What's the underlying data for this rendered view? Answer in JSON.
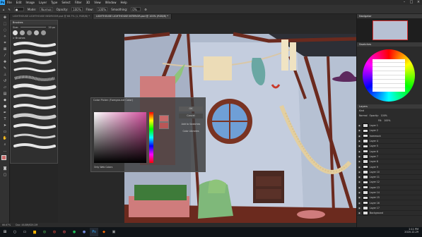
{
  "menubar": {
    "logo": "Ps",
    "items": [
      "File",
      "Edit",
      "Image",
      "Layer",
      "Type",
      "Select",
      "Filter",
      "3D",
      "View",
      "Window",
      "Help"
    ]
  },
  "options": {
    "mode_label": "Mode:",
    "mode_value": "Normal",
    "opacity_label": "Opacity:",
    "opacity_value": "100%",
    "flow_label": "Flow:",
    "flow_value": "100%",
    "smoothing_label": "Smoothing:",
    "smoothing_value": "0%"
  },
  "tabs": [
    {
      "label": "LIGHTHOUSE LIGHTHOUSE BEDROOM.psd @ 66.7% (1, RGB/8) *",
      "active": false
    },
    {
      "label": "LIGHTHOUSE LIGHTHOUSE INTERIOR.psd @ 100% (RGB/8) *",
      "active": true
    }
  ],
  "brush_panel": {
    "title": "Brushes",
    "size_label": "Size:",
    "size_value": "20 px",
    "group": "> Brushes"
  },
  "color_picker": {
    "title": "Color Picker (Foreground Color)",
    "ok": "OK",
    "cancel": "Cancel",
    "add_swatch": "Add to Swatches",
    "libraries": "Color Libraries",
    "only_web": "Only Web Colors"
  },
  "right_dock": {
    "navigator_title": "Navigator",
    "swatches_title": "Swatches",
    "layers_title": "Layers",
    "kind_label": "Kind",
    "blend_mode": "Normal",
    "opacity_label": "Opacity:",
    "opacity_value": "100%",
    "fill_label": "Fill:",
    "fill_value": "100%",
    "layers": [
      "Layer 1",
      "Layer 2",
      "hammock",
      "Layer 4",
      "Layer 5",
      "Layer 6",
      "Layer 7",
      "Layer 8",
      "Layer 9",
      "Layer 10",
      "Layer 11",
      "Layer 12",
      "Layer 13",
      "Layer 14",
      "Layer 15",
      "Layer 16",
      "Layer 17",
      "Background"
    ]
  },
  "status": {
    "zoom": "66.67%",
    "doc": "Doc: 46.8M/629.2M"
  },
  "taskbar": {
    "time": "2:11 PM",
    "date": "2020-12-29"
  },
  "colors": {
    "app_bg": "#262626",
    "wall": "#b9c4d8",
    "beam": "#6b2a1e",
    "ps_blue": "#31a8ff"
  }
}
